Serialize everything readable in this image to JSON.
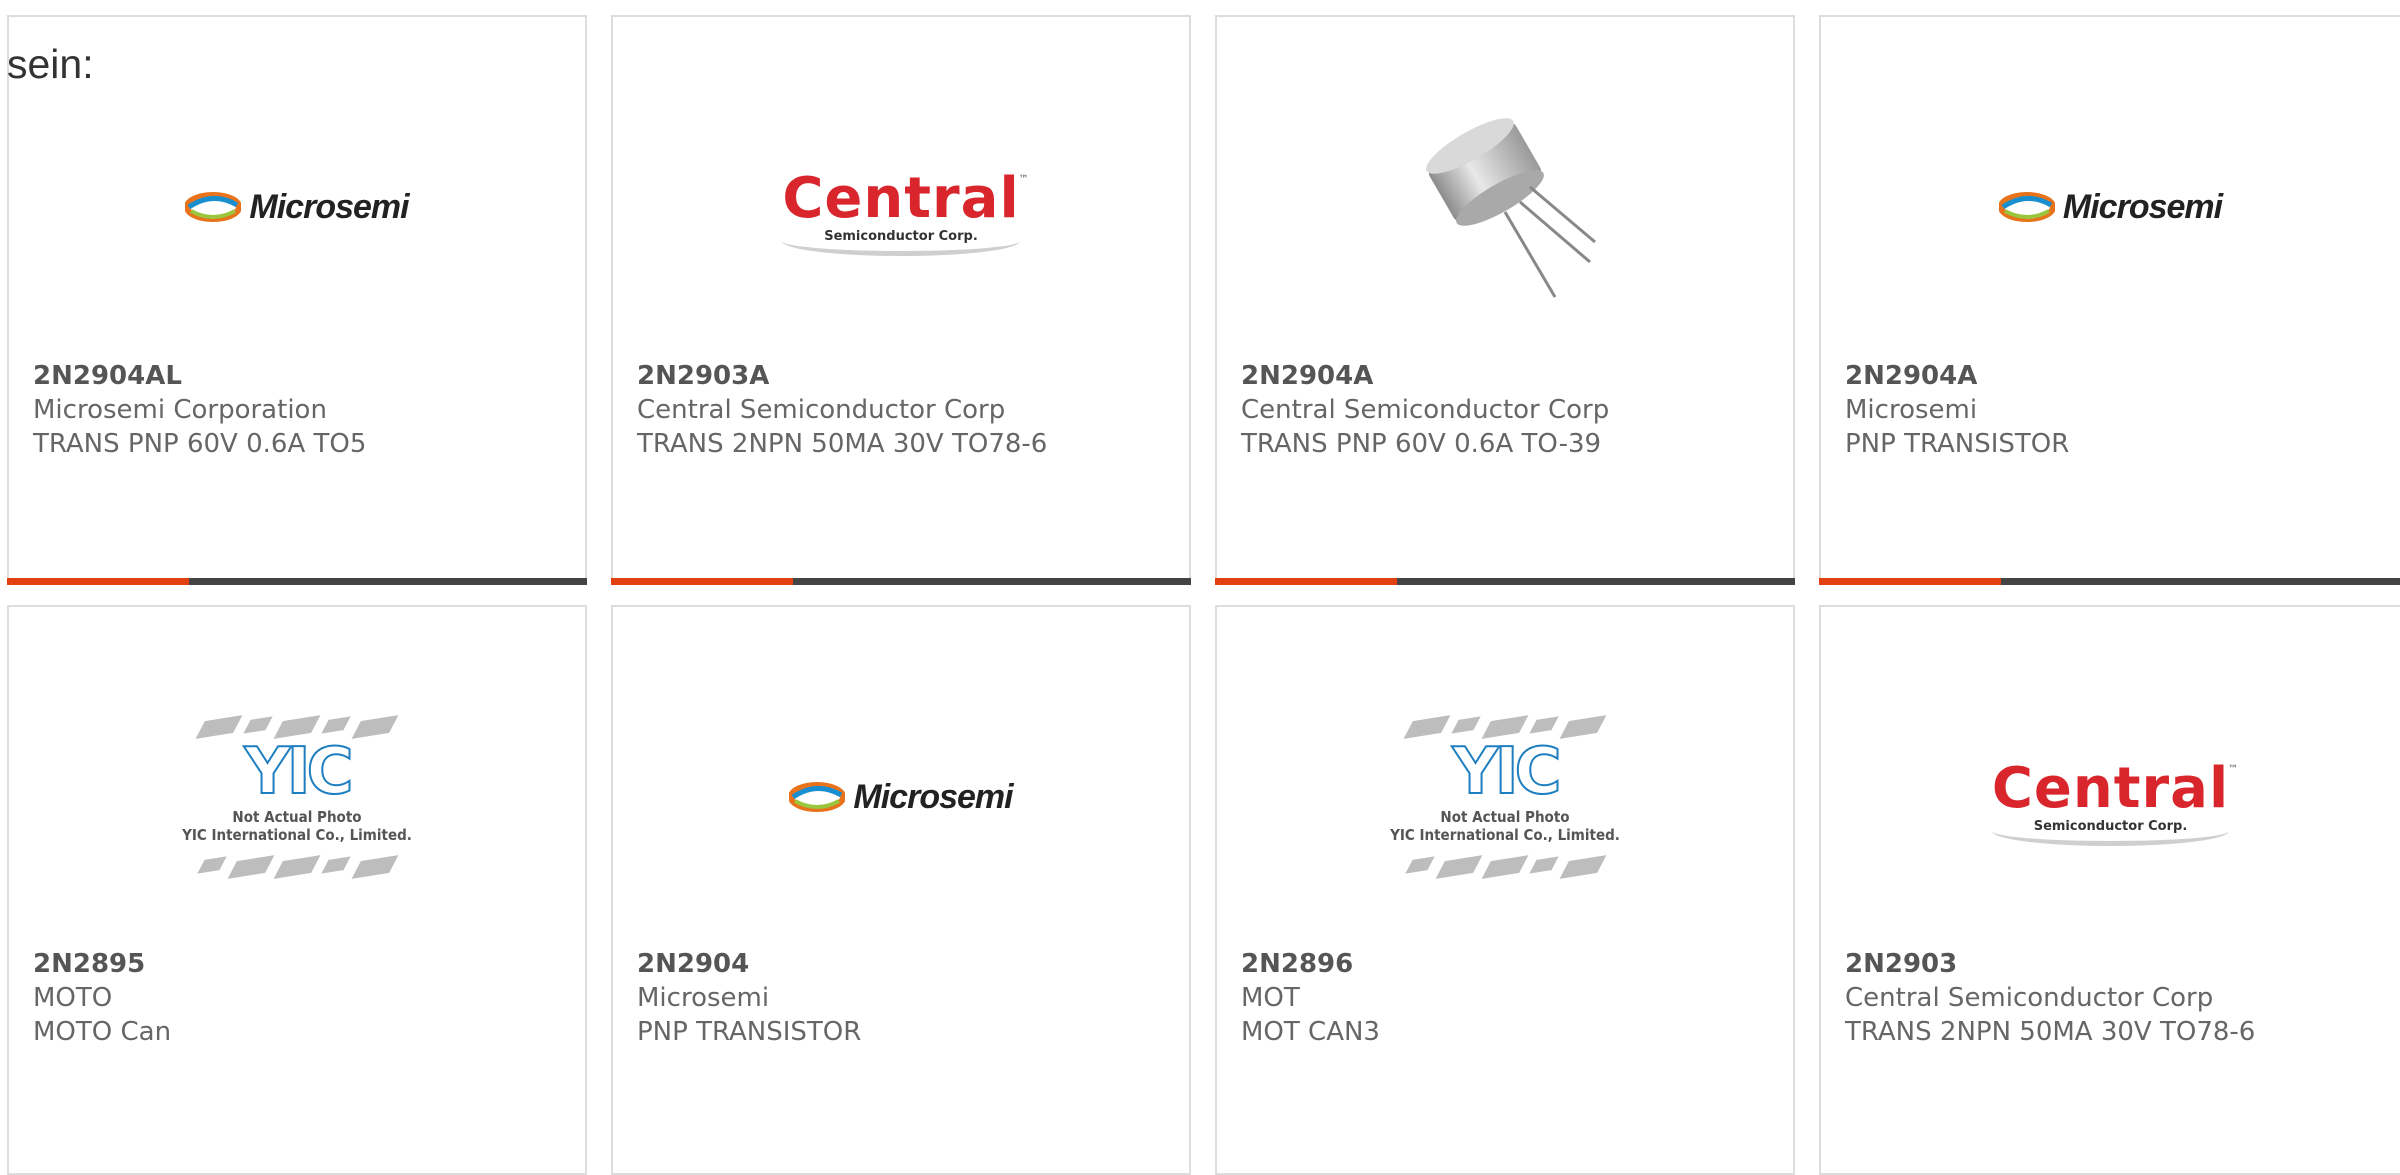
{
  "heading": "sein:",
  "colors": {
    "accent": "#e34011",
    "bar": "#444444",
    "border": "#dddddd",
    "central_red": "#d8262c"
  },
  "products": [
    {
      "part": "2N2904AL",
      "manufacturer": "Microsemi Corporation",
      "description": "TRANS PNP 60V 0.6A TO5",
      "image": "microsemi-logo"
    },
    {
      "part": "2N2903A",
      "manufacturer": "Central Semiconductor Corp",
      "description": "TRANS 2NPN 50MA 30V TO78-6",
      "image": "central-logo"
    },
    {
      "part": "2N2904A",
      "manufacturer": "Central Semiconductor Corp",
      "description": "TRANS PNP 60V 0.6A TO-39",
      "image": "to39-transistor-photo"
    },
    {
      "part": "2N2904A",
      "manufacturer": "Microsemi",
      "description": "PNP TRANSISTOR",
      "image": "microsemi-logo"
    },
    {
      "part": "2N2895",
      "manufacturer": "MOTO",
      "description": "MOTO Can",
      "image": "yic-placeholder"
    },
    {
      "part": "2N2904",
      "manufacturer": "Microsemi",
      "description": "PNP TRANSISTOR",
      "image": "microsemi-logo"
    },
    {
      "part": "2N2896",
      "manufacturer": "MOT",
      "description": "MOT CAN3",
      "image": "yic-placeholder"
    },
    {
      "part": "2N2903",
      "manufacturer": "Central Semiconductor Corp",
      "description": "TRANS 2NPN 50MA 30V TO78-6",
      "image": "central-logo"
    }
  ],
  "logos": {
    "microsemi": "Microsemi",
    "central": "Central",
    "central_tm": "™",
    "central_sub": "Semiconductor Corp.",
    "yic": "YIC",
    "placeholder_line1": "Not Actual Photo",
    "placeholder_line2": "YIC International Co., Limited."
  }
}
